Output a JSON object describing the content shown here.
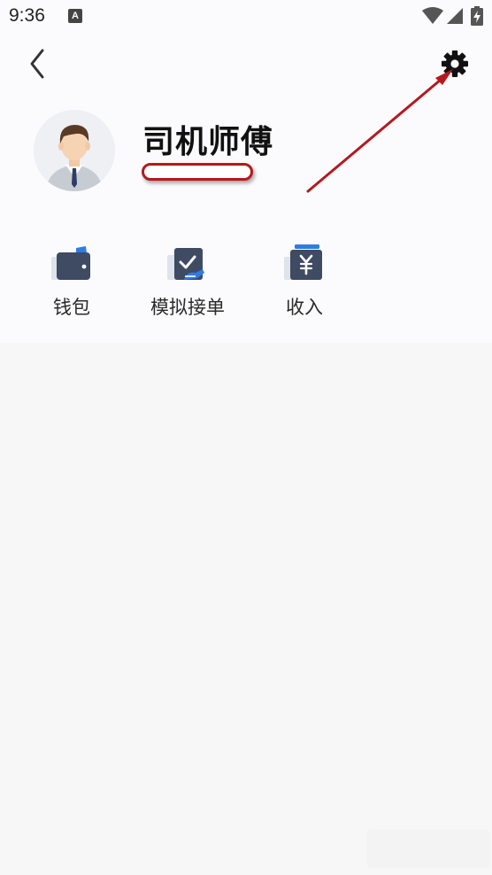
{
  "status_bar": {
    "time": "9:36",
    "notification_letter": "A",
    "icons": [
      "wifi-icon",
      "signal-icon",
      "battery-charging-icon"
    ]
  },
  "header": {
    "back_icon": "chevron-left-icon",
    "settings_icon": "gear-icon",
    "user_name": "司机师傅",
    "avatar_icon": "man-in-suit-avatar-icon"
  },
  "actions": [
    {
      "label": "钱包",
      "icon": "wallet-icon"
    },
    {
      "label": "模拟接单",
      "icon": "simulated-order-icon"
    },
    {
      "label": "收入",
      "icon": "income-yuan-icon"
    }
  ],
  "colors": {
    "header_bg": "#fbfbfd",
    "page_bg": "#f7f7f7",
    "icon_dark": "#3f4a63",
    "icon_light": "#dfe3ea",
    "icon_accent": "#2f7de1",
    "annotation_red": "#b4191e"
  }
}
